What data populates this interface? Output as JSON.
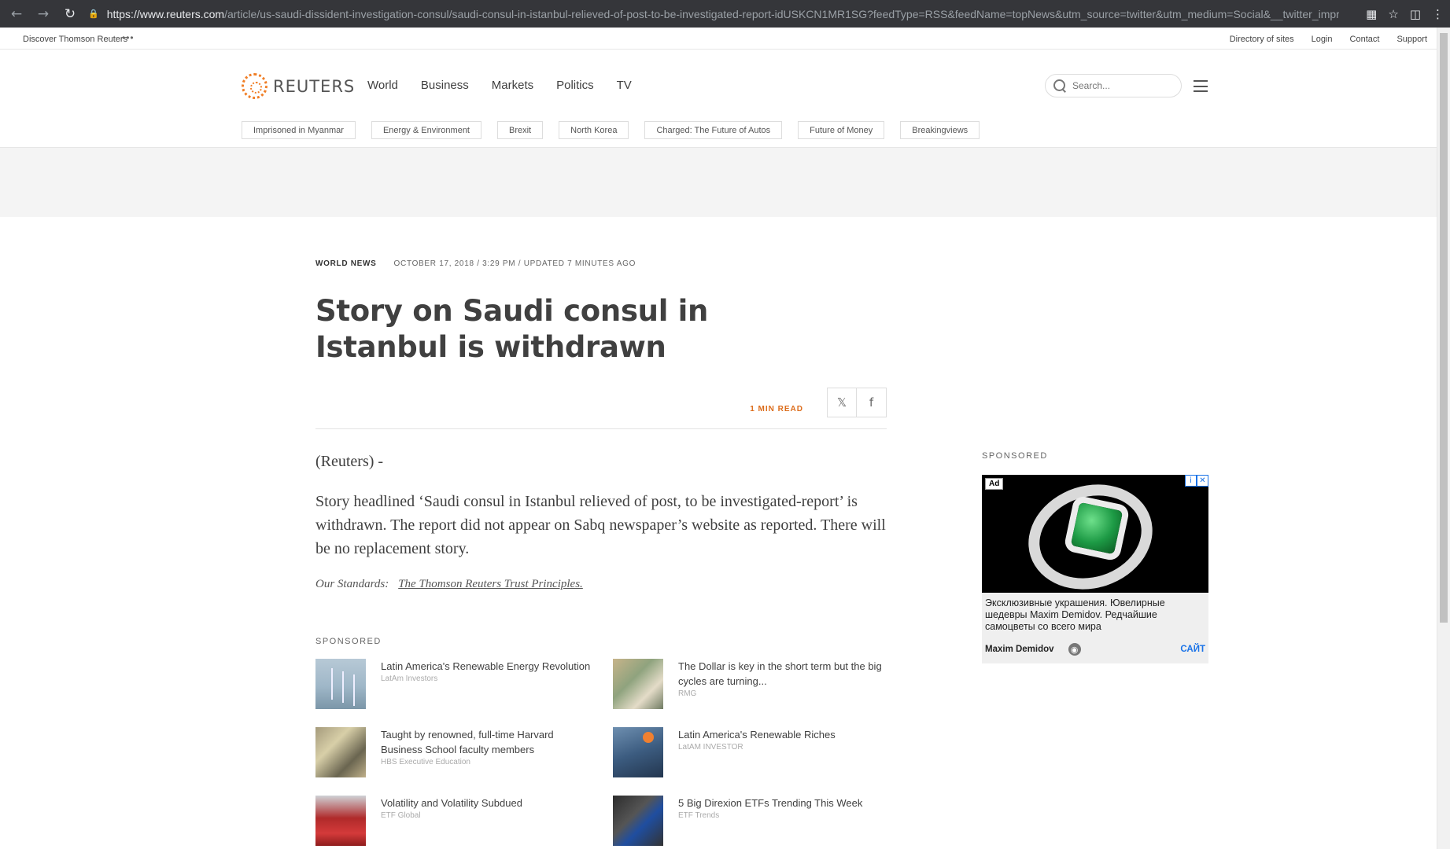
{
  "browser": {
    "url_host": "https://www.reuters.com",
    "url_path": "/article/us-saudi-dissident-investigation-consul/saudi-consul-in-istanbul-relieved-of-post-to-be-investigated-report-idUSKCN1MR1SG?feedType=RSS&feedName=topNews&utm_source=twitter&utm_medium=Social&__twitter_impression=..."
  },
  "utility": {
    "discover": "Discover Thomson Reuters",
    "more": "•••",
    "links": [
      "Directory of sites",
      "Login",
      "Contact",
      "Support"
    ]
  },
  "header": {
    "logo_text": "REUTERS",
    "nav": [
      "World",
      "Business",
      "Markets",
      "Politics",
      "TV"
    ],
    "search_placeholder": "Search..."
  },
  "topics": [
    "Imprisoned in Myanmar",
    "Energy & Environment",
    "Brexit",
    "North Korea",
    "Charged: The Future of Autos",
    "Future of Money",
    "Breakingviews"
  ],
  "article": {
    "section": "WORLD NEWS",
    "timestamp": "OCTOBER 17, 2018 / 3:29 PM / UPDATED 7 MINUTES AGO",
    "headline": "Story on Saudi consul in Istanbul is withdrawn",
    "read_time": "1 MIN READ",
    "dateline": "(Reuters) -",
    "body": "Story headlined ‘Saudi consul in Istanbul relieved of post, to be investigated-report’ is withdrawn. The report did not appear on Sabq newspaper’s website as reported. There will be no replacement story.",
    "standards_label": "Our Standards:",
    "standards_link": "The Thomson Reuters Trust Principles."
  },
  "sponsored": {
    "label": "SPONSORED",
    "items": [
      {
        "title": "Latin America's Renewable Energy Revolution",
        "source": "LatAm Investors"
      },
      {
        "title": "The Dollar is key in the short term but the big cycles are turning...",
        "source": "RMG"
      },
      {
        "title": "Taught by renowned, full-time Harvard Business School faculty members",
        "source": "HBS Executive Education"
      },
      {
        "title": "Latin America's Renewable Riches",
        "source": "LatAM INVESTOR"
      },
      {
        "title": "Volatility and Volatility Subdued",
        "source": "ETF Global"
      },
      {
        "title": "5 Big Direxion ETFs Trending This Week",
        "source": "ETF Trends"
      }
    ]
  },
  "rail": {
    "label": "SPONSORED",
    "ad": {
      "badge": "Ad",
      "copy": "Эксклюзивные украшения. Ювелирные шедевры Maxim Demidov. Редчайшие самоцветы со всего мира",
      "advertiser": "Maxim Demidov",
      "cta": "САЙТ"
    }
  },
  "colors": {
    "accent_orange": "#dc6c1b",
    "logo_orange": "#f07e26",
    "ad_link_blue": "#1a73e8"
  }
}
